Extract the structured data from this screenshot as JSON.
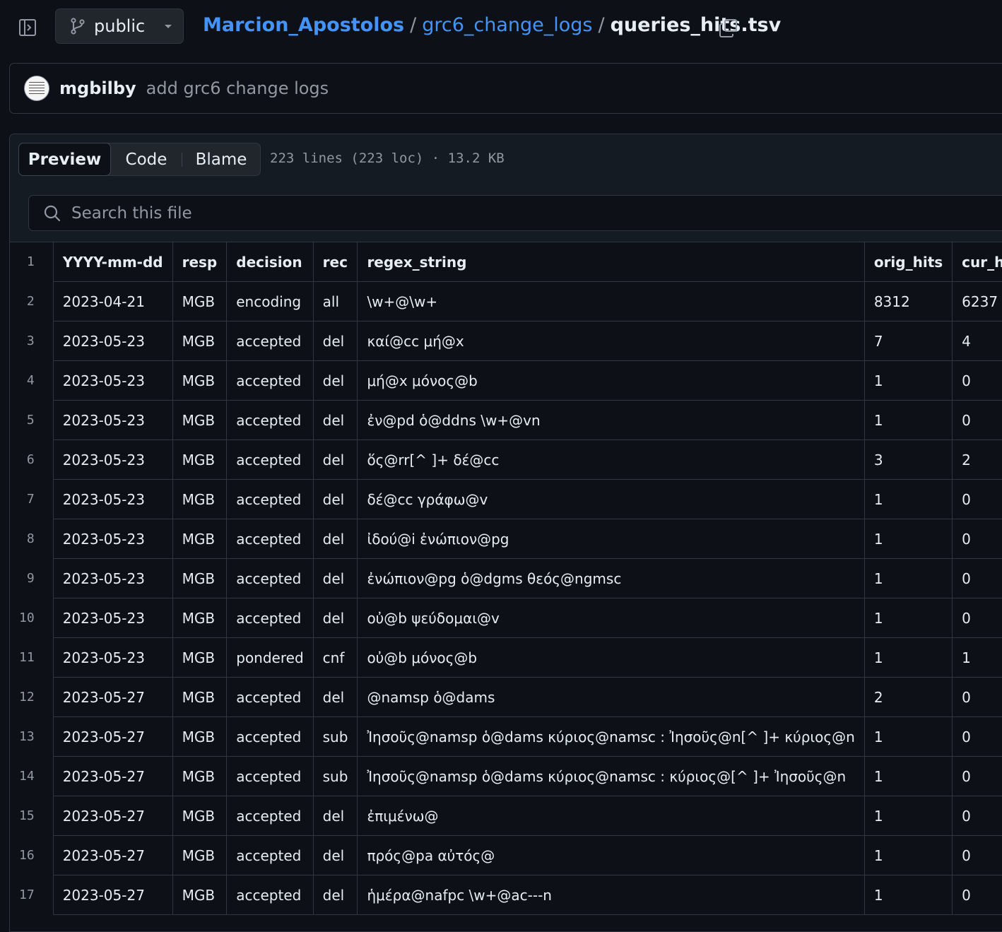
{
  "nav": {
    "branch_label": "public",
    "owner": "Marcion_Apostolos",
    "separator": "/",
    "repo": "grc6_change_logs",
    "file": "queries_hits.tsv"
  },
  "commit": {
    "author": "mgbilby",
    "message": "add grc6 change logs"
  },
  "file_header": {
    "tabs": [
      "Preview",
      "Code",
      "Blame"
    ],
    "active_tab": "Preview",
    "info": "223 lines (223 loc) · 13.2 KB"
  },
  "search": {
    "placeholder": "Search this file"
  },
  "table": {
    "header_line": "1",
    "columns": [
      "YYYY-mm-dd",
      "resp",
      "decision",
      "rec",
      "regex_string",
      "orig_hits",
      "cur_hits"
    ],
    "rows": [
      {
        "line": "2",
        "cells": [
          "2023-04-21",
          "MGB",
          "encoding",
          "all",
          "\\w+@\\w+",
          "8312",
          "6237"
        ]
      },
      {
        "line": "3",
        "cells": [
          "2023-05-23",
          "MGB",
          "accepted",
          "del",
          "καί@cc μή@x",
          "7",
          "4"
        ]
      },
      {
        "line": "4",
        "cells": [
          "2023-05-23",
          "MGB",
          "accepted",
          "del",
          "μή@x μόνος@b",
          "1",
          "0"
        ]
      },
      {
        "line": "5",
        "cells": [
          "2023-05-23",
          "MGB",
          "accepted",
          "del",
          "ἐν@pd ὁ@ddns \\w+@vn",
          "1",
          "0"
        ]
      },
      {
        "line": "6",
        "cells": [
          "2023-05-23",
          "MGB",
          "accepted",
          "del",
          "ὅς@rr[^ ]+ δέ@cc",
          "3",
          "2"
        ]
      },
      {
        "line": "7",
        "cells": [
          "2023-05-23",
          "MGB",
          "accepted",
          "del",
          "δέ@cc γράφω@v",
          "1",
          "0"
        ]
      },
      {
        "line": "8",
        "cells": [
          "2023-05-23",
          "MGB",
          "accepted",
          "del",
          "ἰδού@i ἐνώπιον@pg",
          "1",
          "0"
        ]
      },
      {
        "line": "9",
        "cells": [
          "2023-05-23",
          "MGB",
          "accepted",
          "del",
          "ἐνώπιον@pg ὁ@dgms θεός@ngmsc",
          "1",
          "0"
        ]
      },
      {
        "line": "10",
        "cells": [
          "2023-05-23",
          "MGB",
          "accepted",
          "del",
          "οὐ@b ψεύδομαι@v",
          "1",
          "0"
        ]
      },
      {
        "line": "11",
        "cells": [
          "2023-05-23",
          "MGB",
          "pondered",
          "cnf",
          "οὐ@b μόνος@b",
          "1",
          "1"
        ]
      },
      {
        "line": "12",
        "cells": [
          "2023-05-27",
          "MGB",
          "accepted",
          "del",
          "@namsp ὁ@dams",
          "2",
          "0"
        ]
      },
      {
        "line": "13",
        "cells": [
          "2023-05-27",
          "MGB",
          "accepted",
          "sub",
          "Ἰησοῦς@namsp ὁ@dams κύριος@namsc : Ἰησοῦς@n[^ ]+ κύριος@n",
          "1",
          "0"
        ]
      },
      {
        "line": "14",
        "cells": [
          "2023-05-27",
          "MGB",
          "accepted",
          "sub",
          "Ἰησοῦς@namsp ὁ@dams κύριος@namsc : κύριος@[^ ]+ Ἰησοῦς@n",
          "1",
          "0"
        ]
      },
      {
        "line": "15",
        "cells": [
          "2023-05-27",
          "MGB",
          "accepted",
          "del",
          "ἐπιμένω@",
          "1",
          "0"
        ]
      },
      {
        "line": "16",
        "cells": [
          "2023-05-27",
          "MGB",
          "accepted",
          "del",
          "πρός@pa αὐτός@",
          "1",
          "0"
        ]
      },
      {
        "line": "17",
        "cells": [
          "2023-05-27",
          "MGB",
          "accepted",
          "del",
          "ἡμέρα@nafpc \\w+@ac---n",
          "1",
          "0"
        ]
      }
    ]
  }
}
